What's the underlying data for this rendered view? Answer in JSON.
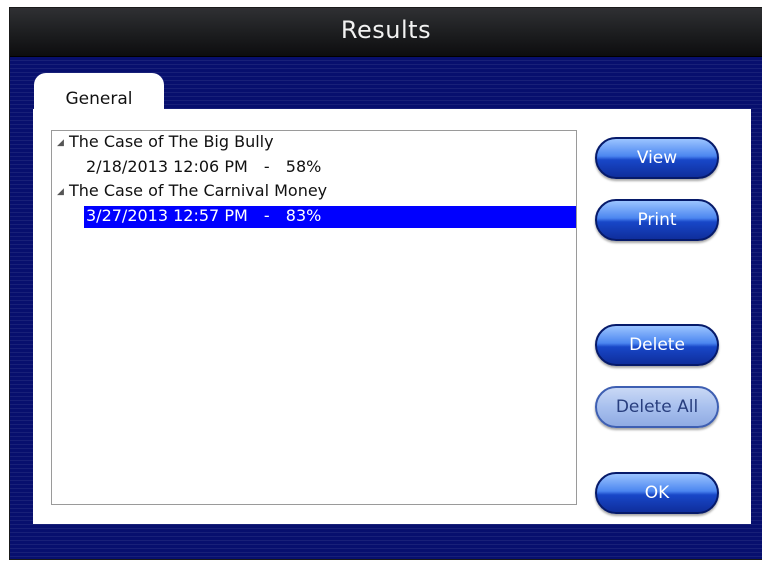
{
  "window": {
    "title": "Results"
  },
  "tabs": [
    {
      "label": "General",
      "active": true
    }
  ],
  "results": [
    {
      "case": "The Case of The Big Bully",
      "expanded": true,
      "entries": [
        {
          "date": "2/18/2013 12:06 PM",
          "separator": "-",
          "score": "58%",
          "selected": false
        }
      ]
    },
    {
      "case": "The Case of The Carnival Money",
      "expanded": true,
      "entries": [
        {
          "date": "3/27/2013 12:57 PM",
          "separator": "-",
          "score": "83%",
          "selected": true
        }
      ]
    }
  ],
  "buttons": {
    "view": {
      "label": "View",
      "enabled": true
    },
    "print": {
      "label": "Print",
      "enabled": true
    },
    "delete": {
      "label": "Delete",
      "enabled": true
    },
    "delete_all": {
      "label": "Delete All",
      "enabled": false
    },
    "ok": {
      "label": "OK",
      "enabled": true
    }
  },
  "icons": {
    "expanded": "triangle-down-icon"
  },
  "colors": {
    "background": "#070f6e",
    "selection": "#0000ff",
    "button": "#1847c8"
  }
}
